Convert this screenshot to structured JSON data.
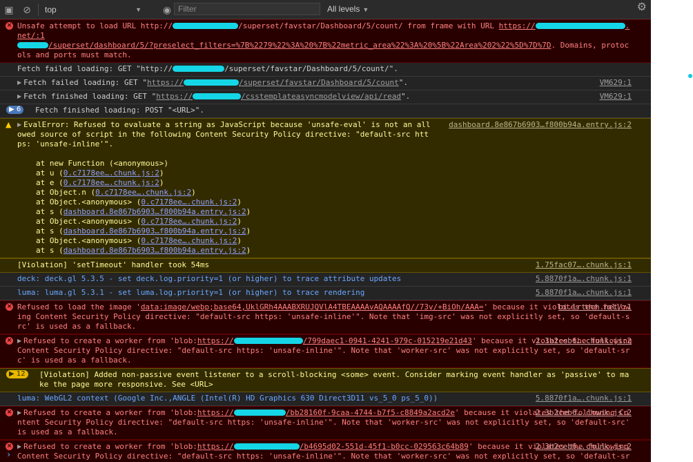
{
  "toolbar": {
    "context": "top",
    "filter_placeholder": "Filter",
    "levels": "All levels"
  },
  "messages": [
    {
      "id": "m1",
      "level": "error",
      "text1": "Unsafe attempt to load URL http://",
      "text2": "/superset/favstar/Dashboard/5/count/ from frame with URL ",
      "link": "https://",
      "link2": ".net/:1",
      "text3": "/superset/dashboard/5/?preselect_filters=%7B%2279%22%3A%20%7B%22metric_area%22%3A%20%5B%22Area%202%22%5D%7D%7D",
      "text4": ". Domains, protocols and ports must match."
    },
    {
      "id": "m2",
      "level": "verbose",
      "text": "Fetch failed loading: GET \"http://",
      "text2": "/superset/favstar/Dashboard/5/count/\"."
    },
    {
      "id": "m3",
      "level": "verbose",
      "text": "Fetch failed loading: GET \"",
      "link": "https://",
      "link2": "/superset/favstar/Dashboard/5/count",
      "end": "\".",
      "src": "VM629:1"
    },
    {
      "id": "m4",
      "level": "verbose",
      "text": "Fetch finished loading: GET \"",
      "link": "https://",
      "link2": "/csstemplateasyncmodelview/api/read",
      "end": "\".",
      "src": "VM629:1"
    },
    {
      "id": "m5",
      "level": "verbose",
      "count": "6",
      "text": "Fetch finished loading: POST \"<URL>\"."
    },
    {
      "id": "m6",
      "level": "warning",
      "text": "EvalError: Refused to evaluate a string as JavaScript because 'unsafe-eval' is not an allowed source of script in the following Content Security Policy directive: \"default-src https: 'unsafe-inline'\".",
      "src": "dashboard.8e867b6903…f800b94a.entry.js:2",
      "stack": [
        {
          "fn": "at new Function (<anonymous>)",
          "file": ""
        },
        {
          "fn": "at u (",
          "file": "0.c7178ee….chunk.js:2"
        },
        {
          "fn": "at e (",
          "file": "0.c7178ee….chunk.js:2"
        },
        {
          "fn": "at Object.n (",
          "file": "0.c7178ee….chunk.js:2"
        },
        {
          "fn": "at Object.<anonymous> (",
          "file": "0.c7178ee….chunk.js:2"
        },
        {
          "fn": "at s (",
          "file": "dashboard.8e867b6903…f800b94a.entry.js:2"
        },
        {
          "fn": "at Object.<anonymous> (",
          "file": "0.c7178ee….chunk.js:2"
        },
        {
          "fn": "at s (",
          "file": "dashboard.8e867b6903…f800b94a.entry.js:2"
        },
        {
          "fn": "at Object.<anonymous> (",
          "file": "0.c7178ee….chunk.js:2"
        },
        {
          "fn": "at s (",
          "file": "dashboard.8e867b6903…f800b94a.entry.js:2"
        }
      ]
    },
    {
      "id": "m7",
      "level": "warning",
      "text": "[Violation] 'setTimeout' handler took 54ms",
      "src": "1.75fac07….chunk.js:1"
    },
    {
      "id": "m8",
      "level": "info",
      "text": "deck: deck.gl 5.3.5 - set deck.log.priority=1 (or higher) to trace attribute updates",
      "src": "5.8870f1a….chunk.js:1"
    },
    {
      "id": "m9",
      "level": "info",
      "text": "luma: luma.gl 5.3.1 - set luma.log.priority=1 (or higher) to trace rendering",
      "src": "5.8870f1a….chunk.js:1"
    },
    {
      "id": "m10",
      "level": "error",
      "text1": "Refused to load the image '",
      "link": "data:image/webp;base64,UklGRh4AAABXRUJQVlA4TBEAAAAvAQAAAAfQ//73v/+BiOh/AAA=",
      "text2": "' because it violates the following Content Security Policy directive: \"default-src https: 'unsafe-inline'\". Note that 'img-src' was not explicitly set, so 'default-src' is used as a fallback.",
      "src": "bi.lrtech.net/:1"
    },
    {
      "id": "m11",
      "level": "error",
      "text1": "Refused to create a worker from 'blob:",
      "link": "https://",
      "link2": "/799daec1-0941-4241-979c-015219e21d43",
      "text2": "' because it violates the following Content Security Policy directive: \"default-src https: 'unsafe-inline'\". Note that 'worker-src' was not explicitly set, so 'default-src' is used as a fallback.",
      "src": "2.3b2ceb6….chunk.js:2"
    },
    {
      "id": "m12",
      "level": "warning",
      "count": "12",
      "text": "[Violation] Added non-passive event listener to a scroll-blocking <some> event. Consider marking event handler as 'passive' to make the page more responsive. See <URL>"
    },
    {
      "id": "m13",
      "level": "info",
      "text": "luma: WebGL2 context (Google Inc.,ANGLE (Intel(R) HD Graphics 630 Direct3D11 vs_5_0 ps_5_0))",
      "src": "5.8870f1a….chunk.js:1"
    },
    {
      "id": "m14",
      "level": "error",
      "text1": "Refused to create a worker from 'blob:",
      "link": "https://",
      "link2": "/bb28160f-9caa-4744-b7f5-c8849a2acd2e",
      "text2": "' because it violates the following Content Security Policy directive: \"default-src https: 'unsafe-inline'\". Note that 'worker-src' was not explicitly set, so 'default-src' is used as a fallback.",
      "src": "2.3b2ceb6….chunk.js:2"
    },
    {
      "id": "m15",
      "level": "error",
      "text1": "Refused to create a worker from 'blob:",
      "link": "https://",
      "link2": "/b4695d02-551d-45f1-b0cc-029563c64b89",
      "text2": "' because it violates the following Content Security Policy directive: \"default-src https: 'unsafe-inline'\". Note that 'worker-src' was not explicitly set, so 'default-src' is used as a fallback.",
      "src": "2.3b2ceb6….chunk.js:2"
    }
  ],
  "prompt": "›",
  "colors": {
    "error_bg": "#290000",
    "error_fg": "#fe8080",
    "warn_bg": "#332b00",
    "warn_fg": "#fefa9a",
    "info_fg": "#6aa7ff",
    "redaction": "#15d6e6"
  }
}
